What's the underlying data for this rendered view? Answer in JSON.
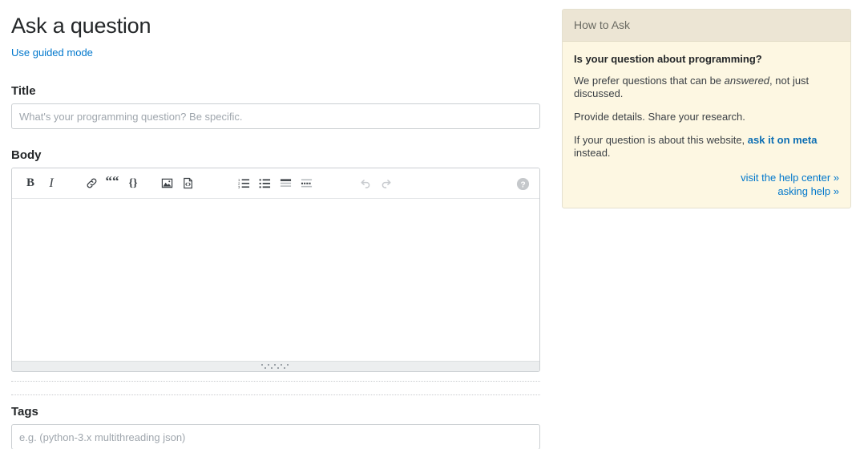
{
  "page": {
    "title": "Ask a question",
    "guided_mode_link": "Use guided mode"
  },
  "title_field": {
    "label": "Title",
    "placeholder": "What's your programming question? Be specific.",
    "value": ""
  },
  "body_field": {
    "label": "Body",
    "value": ""
  },
  "tags_field": {
    "label": "Tags",
    "placeholder": "e.g. (python-3.x multithreading json)",
    "value": ""
  },
  "toolbar": {
    "bold": "B",
    "italic": "I",
    "link": "link-icon",
    "blockquote": "“",
    "code_braces": "{}",
    "image": "image-icon",
    "code_snippet": "code-snippet-icon",
    "numbered_list": "numbered-list-icon",
    "bulleted_list": "bulleted-list-icon",
    "heading": "heading-icon",
    "horizontal_rule": "horizontal-rule-icon",
    "undo": "undo-icon",
    "redo": "redo-icon",
    "help": "help-icon"
  },
  "sidebar": {
    "header": "How to Ask",
    "heading": "Is your question about programming?",
    "p1_before": "We prefer questions that can be ",
    "p1_em": "answered",
    "p1_after": ", not just discussed.",
    "p2": "Provide details. Share your research.",
    "p3_before": "If your question is about this website, ",
    "p3_link": "ask it on meta",
    "p3_after": " instead.",
    "footer_links": [
      "visit the help center »",
      "asking help »"
    ]
  },
  "colors": {
    "link": "#0077cc",
    "sidebar_bg": "#fdf7e2",
    "sidebar_header_bg": "#ece5d4",
    "sidebar_border": "#e4e0cf",
    "input_border": "#cbcfd2",
    "text": "#242729"
  }
}
